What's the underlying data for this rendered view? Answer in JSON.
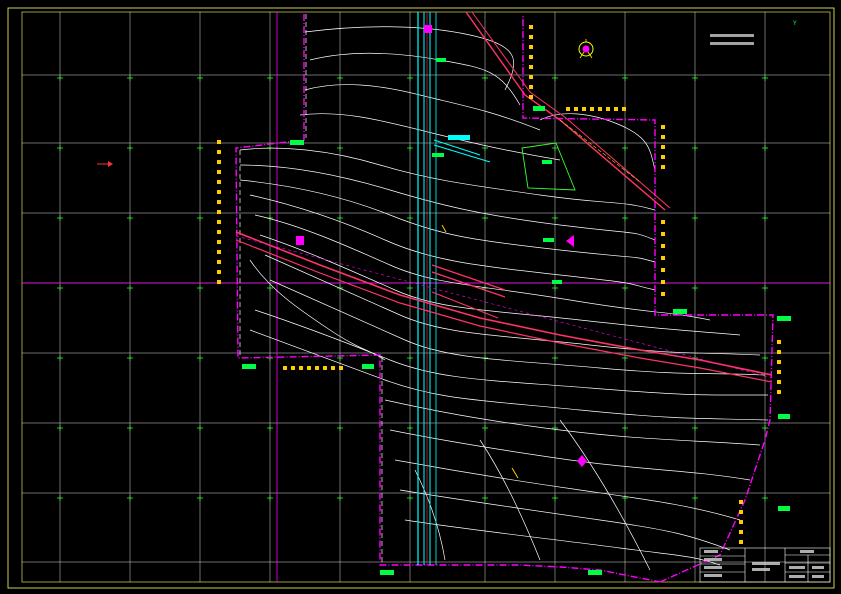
{
  "colors": {
    "background": "#000000",
    "frame": "#ffff66",
    "grid": "#ffffff",
    "grid_cross": "#33ff33",
    "boundary": "#ff00ff",
    "contour": "#ffffff",
    "road": "#ff3366",
    "canal": "#00ffff",
    "labels": "#ffcc00",
    "green_labels": "#00ff44"
  },
  "icons": {
    "north_arrow": "north-arrow-icon"
  },
  "notes": {
    "line1": "",
    "line2": ""
  },
  "title_block": {
    "project": "",
    "drawing_name": "",
    "drawing_no": ""
  }
}
